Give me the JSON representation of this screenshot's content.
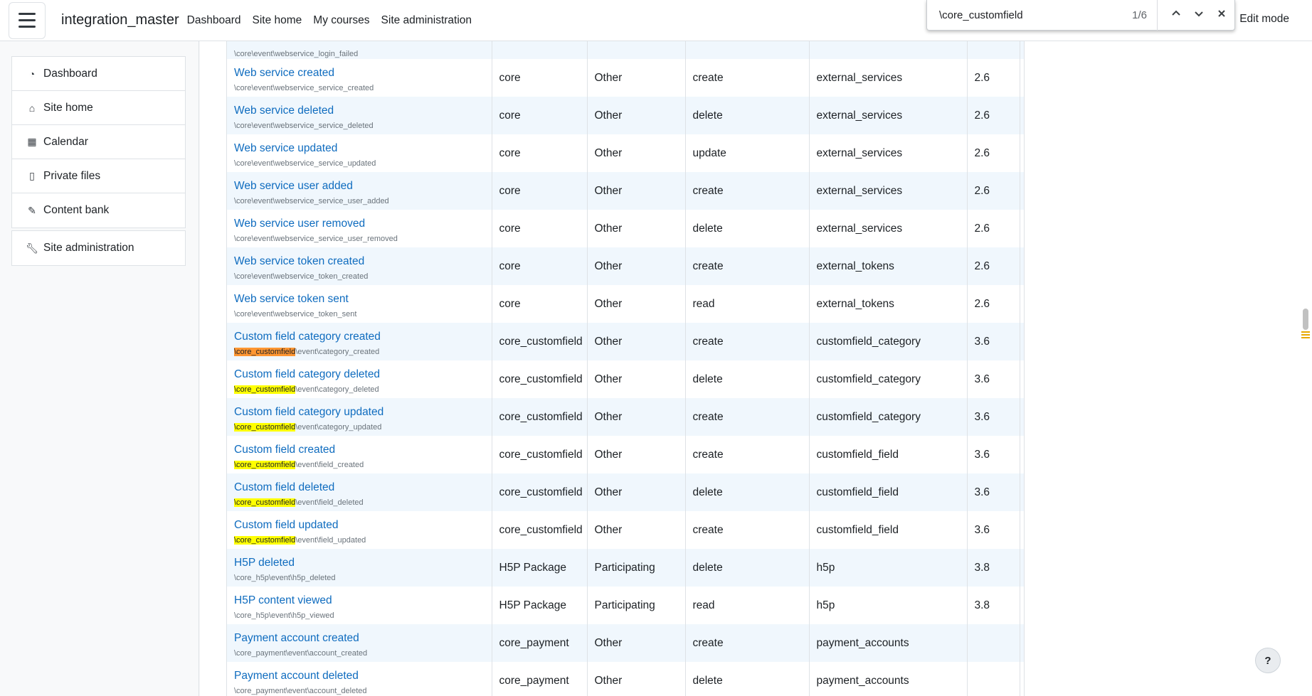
{
  "navbar": {
    "site_name": "integration_master",
    "links": [
      "Dashboard",
      "Site home",
      "My courses",
      "Site administration"
    ],
    "edit_mode": "Edit mode"
  },
  "findbar": {
    "query": "\\core_customfield",
    "count": "1/6"
  },
  "drawer": {
    "items": [
      {
        "label": "Dashboard",
        "icon": "dashboard-icon"
      },
      {
        "label": "Site home",
        "icon": "home-icon"
      },
      {
        "label": "Calendar",
        "icon": "calendar-icon"
      },
      {
        "label": "Private files",
        "icon": "file-icon"
      },
      {
        "label": "Content bank",
        "icon": "paintbrush-icon"
      }
    ],
    "admin": {
      "label": "Site administration",
      "icon": "wrench-icon"
    }
  },
  "table": {
    "first_row_class": "\\core\\event\\webservice_login_failed",
    "rows": [
      {
        "name": "Web service created",
        "class": "\\core\\event\\webservice_service_created",
        "component": "core",
        "edulevel": "Other",
        "crud": "create",
        "table": "external_services",
        "since": "2.6"
      },
      {
        "name": "Web service deleted",
        "class": "\\core\\event\\webservice_service_deleted",
        "component": "core",
        "edulevel": "Other",
        "crud": "delete",
        "table": "external_services",
        "since": "2.6"
      },
      {
        "name": "Web service updated",
        "class": "\\core\\event\\webservice_service_updated",
        "component": "core",
        "edulevel": "Other",
        "crud": "update",
        "table": "external_services",
        "since": "2.6"
      },
      {
        "name": "Web service user added",
        "class": "\\core\\event\\webservice_service_user_added",
        "component": "core",
        "edulevel": "Other",
        "crud": "create",
        "table": "external_services",
        "since": "2.6"
      },
      {
        "name": "Web service user removed",
        "class": "\\core\\event\\webservice_service_user_removed",
        "component": "core",
        "edulevel": "Other",
        "crud": "delete",
        "table": "external_services",
        "since": "2.6"
      },
      {
        "name": "Web service token created",
        "class": "\\core\\event\\webservice_token_created",
        "component": "core",
        "edulevel": "Other",
        "crud": "create",
        "table": "external_tokens",
        "since": "2.6"
      },
      {
        "name": "Web service token sent",
        "class": "\\core\\event\\webservice_token_sent",
        "component": "core",
        "edulevel": "Other",
        "crud": "read",
        "table": "external_tokens",
        "since": "2.6"
      },
      {
        "name": "Custom field category created",
        "class_hl": "\\core_customfield",
        "class_rest": "\\event\\category_created",
        "active": true,
        "component": "core_customfield",
        "edulevel": "Other",
        "crud": "create",
        "table": "customfield_category",
        "since": "3.6"
      },
      {
        "name": "Custom field category deleted",
        "class_hl": "\\core_customfield",
        "class_rest": "\\event\\category_deleted",
        "component": "core_customfield",
        "edulevel": "Other",
        "crud": "delete",
        "table": "customfield_category",
        "since": "3.6"
      },
      {
        "name": "Custom field category updated",
        "class_hl": "\\core_customfield",
        "class_rest": "\\event\\category_updated",
        "component": "core_customfield",
        "edulevel": "Other",
        "crud": "create",
        "table": "customfield_category",
        "since": "3.6"
      },
      {
        "name": "Custom field created",
        "class_hl": "\\core_customfield",
        "class_rest": "\\event\\field_created",
        "component": "core_customfield",
        "edulevel": "Other",
        "crud": "create",
        "table": "customfield_field",
        "since": "3.6"
      },
      {
        "name": "Custom field deleted",
        "class_hl": "\\core_customfield",
        "class_rest": "\\event\\field_deleted",
        "component": "core_customfield",
        "edulevel": "Other",
        "crud": "delete",
        "table": "customfield_field",
        "since": "3.6"
      },
      {
        "name": "Custom field updated",
        "class_hl": "\\core_customfield",
        "class_rest": "\\event\\field_updated",
        "component": "core_customfield",
        "edulevel": "Other",
        "crud": "create",
        "table": "customfield_field",
        "since": "3.6"
      },
      {
        "name": "H5P deleted",
        "class": "\\core_h5p\\event\\h5p_deleted",
        "component": "H5P Package",
        "edulevel": "Participating",
        "crud": "delete",
        "table": "h5p",
        "since": "3.8"
      },
      {
        "name": "H5P content viewed",
        "class": "\\core_h5p\\event\\h5p_viewed",
        "component": "H5P Package",
        "edulevel": "Participating",
        "crud": "read",
        "table": "h5p",
        "since": "3.8"
      },
      {
        "name": "Payment account created",
        "class": "\\core_payment\\event\\account_created",
        "component": "core_payment",
        "edulevel": "Other",
        "crud": "create",
        "table": "payment_accounts",
        "since": ""
      },
      {
        "name": "Payment account deleted",
        "class": "\\core_payment\\event\\account_deleted",
        "component": "core_payment",
        "edulevel": "Other",
        "crud": "delete",
        "table": "payment_accounts",
        "since": ""
      }
    ]
  },
  "help_button": "?",
  "colors": {
    "link": "#0f6cbf",
    "highlight": "#ffff00",
    "active_highlight": "#ff9632",
    "row_stripe": "#f0f7fd"
  }
}
